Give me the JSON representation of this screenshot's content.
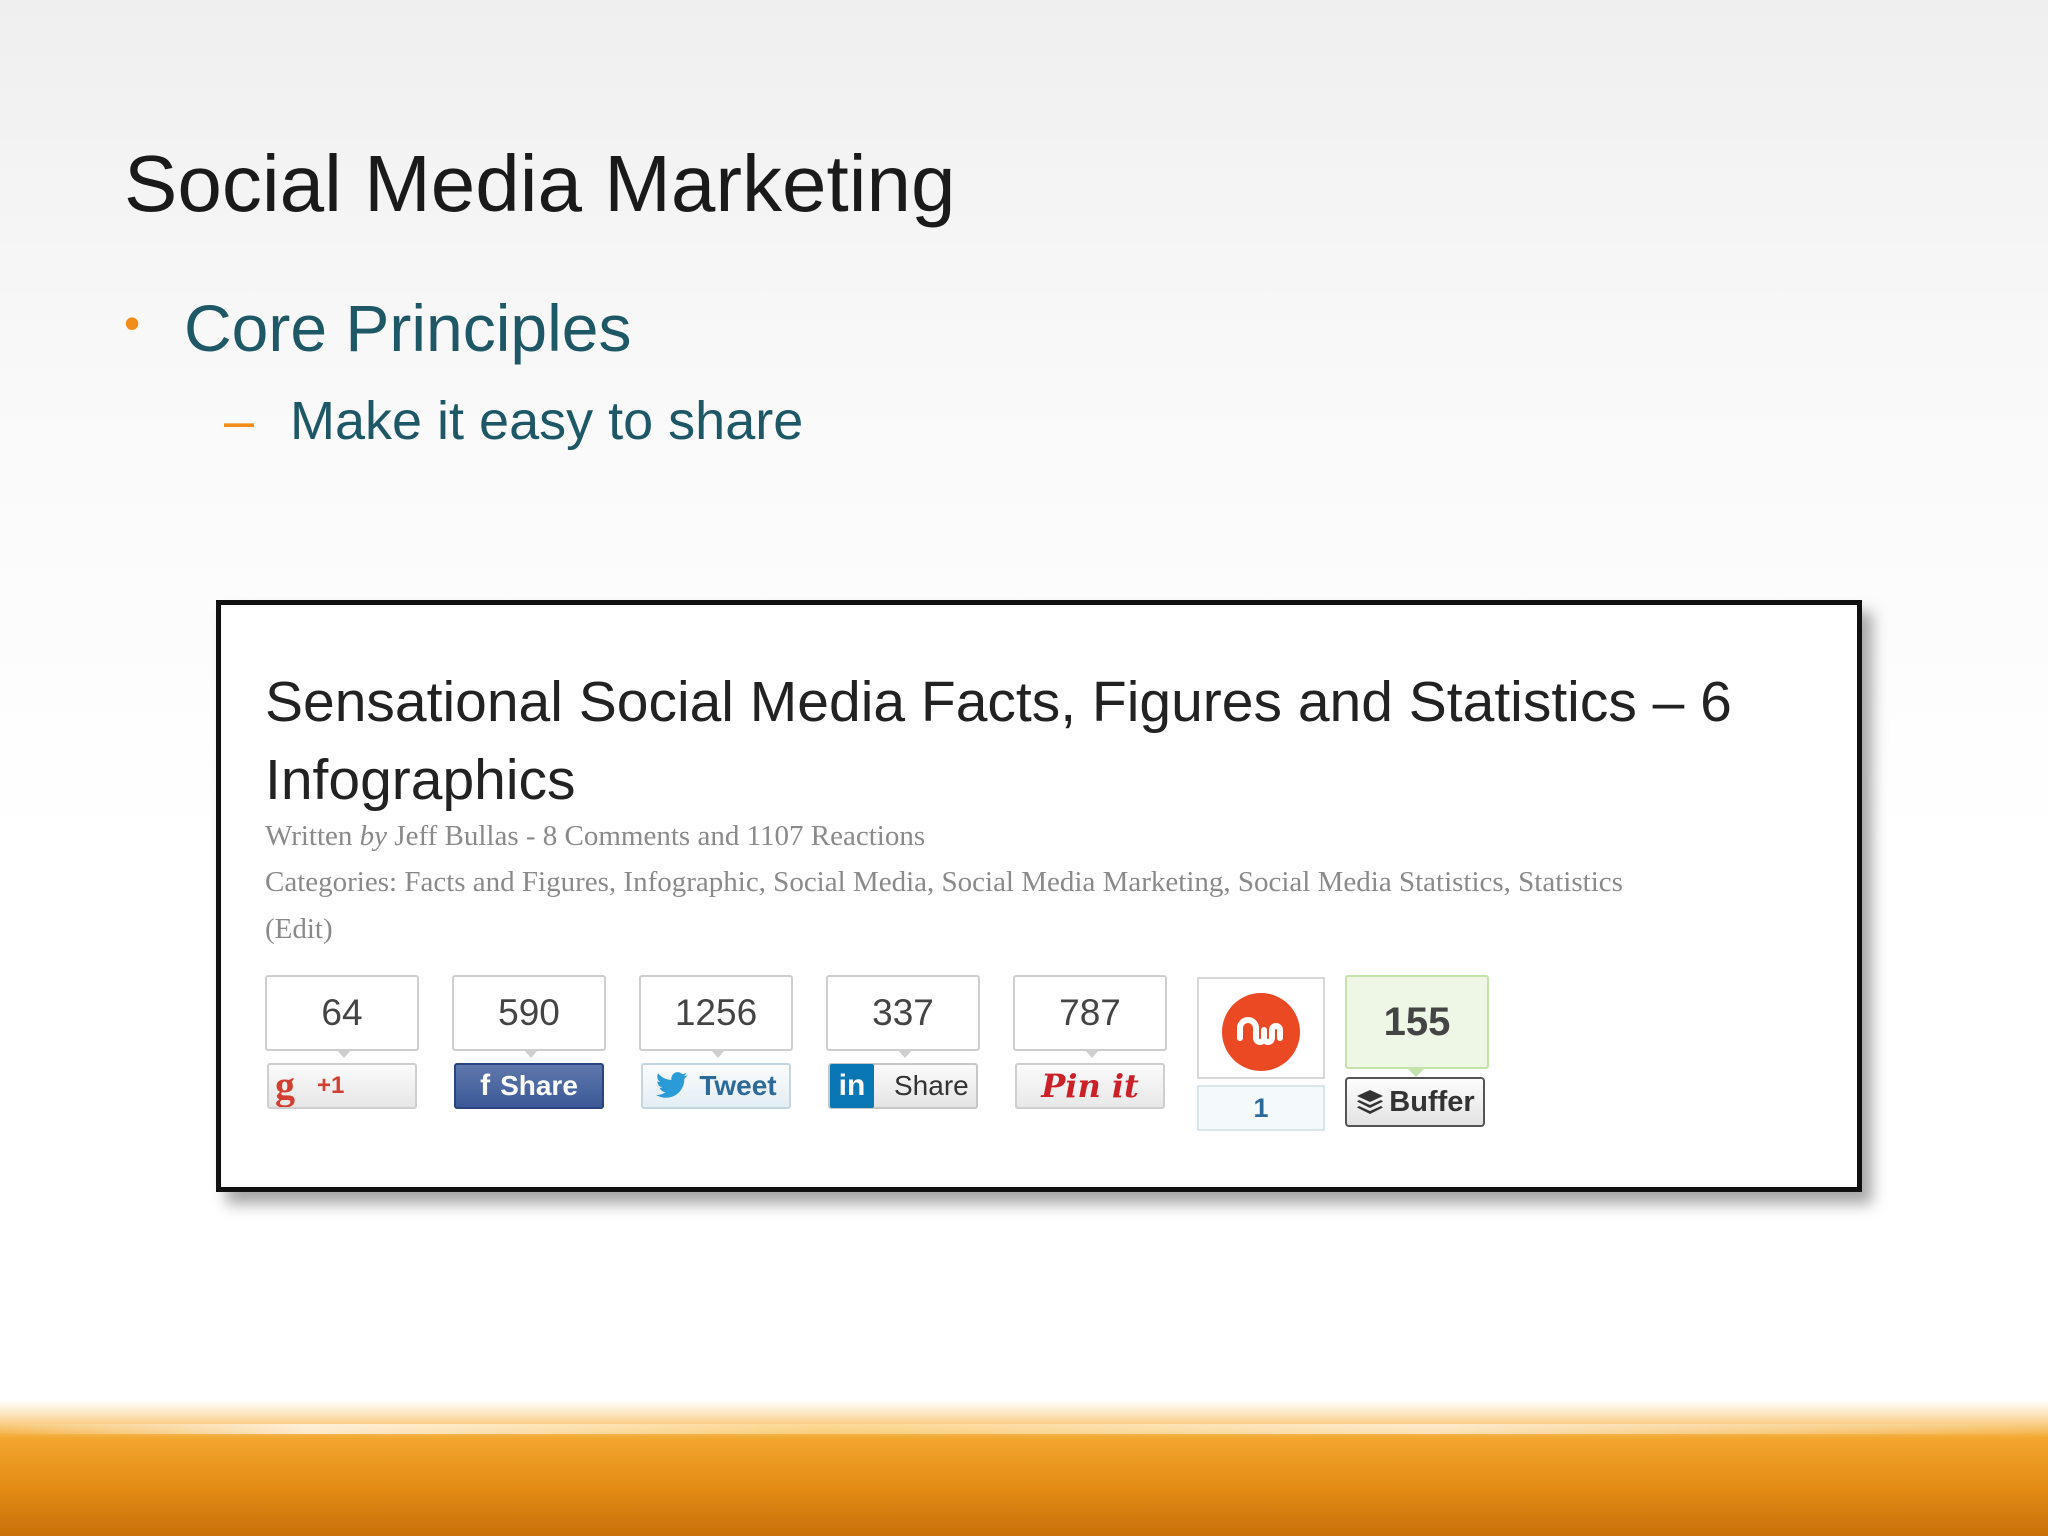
{
  "slide": {
    "title": "Social Media Marketing",
    "bullet": "Core Principles",
    "sub_bullet": "Make it easy to share",
    "bullet_marker": "•",
    "sub_marker": "–"
  },
  "post": {
    "title": "Sensational Social Media Facts, Figures and Statistics – 6 Infographics",
    "meta": {
      "written_prefix": "Written ",
      "by": "by",
      "author": "Jeff Bullas",
      "separator": " - ",
      "comments": "8 Comments",
      "and": " and ",
      "reactions": "1107 Reactions",
      "categories_label": "Categories: ",
      "categories": "Facts and Figures, Infographic, Social Media, Social Media Marketing, Social Media Statistics, Statistics",
      "edit": "(Edit)"
    }
  },
  "share": {
    "gplus": {
      "count": "64",
      "label": "+1",
      "icon": "g-icon-glyph"
    },
    "facebook": {
      "count": "590",
      "label": "Share",
      "icon": "f"
    },
    "twitter": {
      "count": "1256",
      "label": "Tweet"
    },
    "linkedin": {
      "count": "337",
      "label": "Share",
      "icon": "in"
    },
    "pinterest": {
      "count": "787",
      "label": "Pin it"
    },
    "stumbleupon": {
      "count": "1"
    },
    "buffer": {
      "count": "155",
      "label": "Buffer"
    }
  },
  "colors": {
    "accent_orange": "#f28c1a",
    "bullet_teal": "#1e5766",
    "facebook_blue": "#3b5998",
    "twitter_blue": "#2b6a99",
    "linkedin_blue": "#0a77b5",
    "pinterest_red": "#cb2027",
    "stumbleupon_red": "#eb4924",
    "buffer_green": "#c4e3ac"
  }
}
